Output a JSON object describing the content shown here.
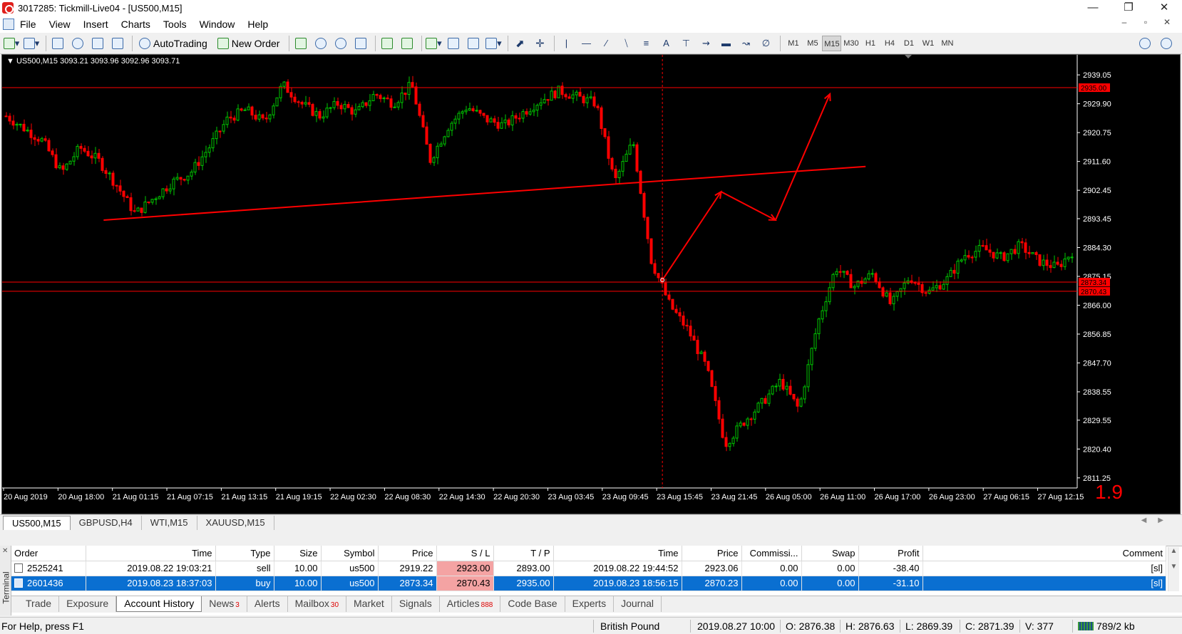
{
  "window": {
    "title": "3017285: Tickmill-Live04 - [US500,M15]",
    "controls": [
      "—",
      "❐",
      "✕"
    ]
  },
  "menu": {
    "items": [
      "File",
      "View",
      "Insert",
      "Charts",
      "Tools",
      "Window",
      "Help"
    ],
    "mdi_controls": [
      "–",
      "▫",
      "✕"
    ]
  },
  "toolbar": {
    "autotrading_label": "AutoTrading",
    "new_order_label": "New Order",
    "timeframes": [
      "M1",
      "M5",
      "M15",
      "M30",
      "H1",
      "H4",
      "D1",
      "W1",
      "MN"
    ],
    "active_timeframe": "M15",
    "text_tool_label": "A",
    "search_icon": "search-icon"
  },
  "chart": {
    "symbol_info": "▼ US500,M15  3093.21 3093.96 3092.96 3093.71",
    "spread_label": "1.9",
    "colors": {
      "background": "#000000",
      "bull": "#00c800",
      "bear": "#ff0000",
      "lines": "#ff0000",
      "axis_text": "#ffffff"
    }
  },
  "chart_data": {
    "type": "candlestick",
    "symbol": "US500",
    "timeframe": "M15",
    "price_axis": [
      "2939.05",
      "2929.90",
      "2920.75",
      "2911.60",
      "2902.45",
      "2893.45",
      "2884.30",
      "2875.15",
      "2866.00",
      "2856.85",
      "2847.70",
      "2838.55",
      "2829.55",
      "2820.40",
      "2811.25"
    ],
    "ylim": [
      2808.5,
      2944.5
    ],
    "time_axis": [
      "20 Aug 2019",
      "20 Aug 18:00",
      "21 Aug 01:15",
      "21 Aug 07:15",
      "21 Aug 13:15",
      "21 Aug 19:15",
      "22 Aug 02:30",
      "22 Aug 08:30",
      "22 Aug 14:30",
      "22 Aug 20:30",
      "23 Aug 03:45",
      "23 Aug 09:45",
      "23 Aug 15:45",
      "23 Aug 21:45",
      "26 Aug 05:00",
      "26 Aug 11:00",
      "26 Aug 17:00",
      "26 Aug 23:00",
      "27 Aug 06:15",
      "27 Aug 12:15"
    ],
    "price_path": [
      [
        0,
        2926
      ],
      [
        1,
        2922
      ],
      [
        2,
        2918
      ],
      [
        3,
        2908
      ],
      [
        4,
        2916
      ],
      [
        5,
        2912
      ],
      [
        6,
        2904
      ],
      [
        7,
        2895
      ],
      [
        8,
        2900
      ],
      [
        9,
        2905
      ],
      [
        10,
        2908
      ],
      [
        11,
        2916
      ],
      [
        12,
        2925
      ],
      [
        13,
        2928
      ],
      [
        14,
        2924
      ],
      [
        15,
        2936
      ],
      [
        16,
        2930
      ],
      [
        17,
        2926
      ],
      [
        18,
        2930
      ],
      [
        19,
        2927
      ],
      [
        20,
        2933
      ],
      [
        21,
        2930
      ],
      [
        22,
        2936
      ],
      [
        23,
        2912
      ],
      [
        24,
        2923
      ],
      [
        25,
        2929
      ],
      [
        26,
        2925
      ],
      [
        27,
        2923
      ],
      [
        28,
        2927
      ],
      [
        29,
        2931
      ],
      [
        30,
        2934
      ],
      [
        31,
        2932
      ],
      [
        32,
        2930
      ],
      [
        33,
        2905
      ],
      [
        34,
        2918
      ],
      [
        35,
        2880
      ],
      [
        36,
        2866
      ],
      [
        37,
        2858
      ],
      [
        38,
        2846
      ],
      [
        39,
        2822
      ],
      [
        40,
        2829
      ],
      [
        41,
        2835
      ],
      [
        42,
        2842
      ],
      [
        43,
        2833
      ],
      [
        44,
        2860
      ],
      [
        45,
        2878
      ],
      [
        46,
        2872
      ],
      [
        47,
        2876
      ],
      [
        48,
        2866
      ],
      [
        49,
        2875
      ],
      [
        50,
        2870
      ],
      [
        51,
        2874
      ],
      [
        52,
        2882
      ],
      [
        53,
        2884
      ],
      [
        54,
        2881
      ],
      [
        55,
        2885
      ],
      [
        56,
        2880
      ],
      [
        57,
        2878
      ],
      [
        58,
        2884
      ]
    ],
    "horizontal_levels": [
      {
        "price": 2935.0,
        "label": "2935.00"
      },
      {
        "price": 2873.34,
        "label": "2873.34"
      },
      {
        "price": 2870.43,
        "label": "2870.43"
      }
    ],
    "trend_line": {
      "from": {
        "x_label": "20 Aug 18:00",
        "price": 2893
      },
      "to": {
        "x_label": "26 Aug 11:00",
        "price": 2910
      }
    },
    "vertical_marker": {
      "x_label": "23 Aug 15:45"
    },
    "drawn_path": [
      [
        "23 Aug 15:45",
        2874
      ],
      [
        "23 Aug 21:45",
        2902
      ],
      [
        "26 Aug 05:00",
        2893
      ],
      [
        "26 Aug 11:00",
        2933
      ]
    ]
  },
  "chart_tabs": [
    "US500,M15",
    "GBPUSD,H4",
    "WTI,M15",
    "XAUUSD,M15"
  ],
  "terminal": {
    "side_label": "Terminal",
    "columns": [
      "Order",
      "Time",
      "Type",
      "Size",
      "Symbol",
      "Price",
      "S / L",
      "T / P",
      "Time",
      "Price",
      "Commissi...",
      "Swap",
      "Profit",
      "Comment"
    ],
    "rows": [
      [
        "2525241",
        "2019.08.22 19:03:21",
        "sell",
        "10.00",
        "us500",
        "2919.22",
        "2923.00",
        "2893.00",
        "2019.08.22 19:44:52",
        "2923.06",
        "0.00",
        "0.00",
        "-38.40",
        "[sl]"
      ],
      [
        "2601436",
        "2019.08.23 18:37:03",
        "buy",
        "10.00",
        "us500",
        "2873.34",
        "2870.43",
        "2935.00",
        "2019.08.23 18:56:15",
        "2870.23",
        "0.00",
        "0.00",
        "-31.10",
        "[sl]"
      ]
    ],
    "selected_row": 1,
    "tabs": [
      {
        "label": "Trade",
        "badge": ""
      },
      {
        "label": "Exposure",
        "badge": ""
      },
      {
        "label": "Account History",
        "badge": ""
      },
      {
        "label": "News",
        "badge": "3"
      },
      {
        "label": "Alerts",
        "badge": ""
      },
      {
        "label": "Mailbox",
        "badge": "30"
      },
      {
        "label": "Market",
        "badge": ""
      },
      {
        "label": "Signals",
        "badge": ""
      },
      {
        "label": "Articles",
        "badge": "888"
      },
      {
        "label": "Code Base",
        "badge": ""
      },
      {
        "label": "Experts",
        "badge": ""
      },
      {
        "label": "Journal",
        "badge": ""
      }
    ],
    "active_tab": "Account History"
  },
  "status": {
    "help": "For Help, press F1",
    "profile": "British Pound",
    "datetime": "2019.08.27 10:00",
    "open": "O: 2876.38",
    "high": "H: 2876.63",
    "low": "L: 2869.39",
    "close": "C: 2871.39",
    "volume": "V: 377",
    "traffic": "789/2 kb"
  }
}
